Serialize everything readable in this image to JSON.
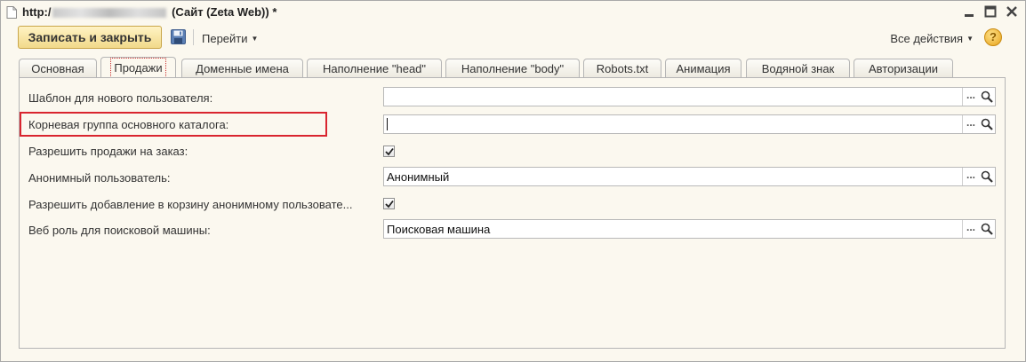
{
  "window": {
    "title_prefix": "http:/",
    "title_suffix": " (Сайт (Zeta Web)) *",
    "controls": [
      "minimize",
      "maximize",
      "close"
    ]
  },
  "toolbar": {
    "primary_label": "Записать и закрыть",
    "goto_label": "Перейти",
    "all_actions_label": "Все действия",
    "help_label": "?"
  },
  "tabs": [
    {
      "label": "Основная",
      "active": false
    },
    {
      "label": "Продажи",
      "active": true
    },
    {
      "label": "Доменные имена",
      "active": false
    },
    {
      "label": "Наполнение \"head\"",
      "active": false
    },
    {
      "label": "Наполнение \"body\"",
      "active": false
    },
    {
      "label": "Robots.txt",
      "active": false
    },
    {
      "label": "Анимация",
      "active": false
    },
    {
      "label": "Водяной знак",
      "active": false
    },
    {
      "label": "Авторизации",
      "active": false
    }
  ],
  "form": {
    "new_user_template": {
      "label": "Шаблон для нового пользователя:",
      "value": ""
    },
    "root_group": {
      "label": "Корневая группа основного каталога:",
      "value": ""
    },
    "allow_orders": {
      "label": "Разрешить продажи на заказ:",
      "checked": true
    },
    "anonymous_user": {
      "label": "Анонимный пользователь:",
      "value": "Анонимный"
    },
    "allow_anon_cart": {
      "label": "Разрешить добавление в корзину анонимному пользовате...",
      "checked": true
    },
    "search_engine_role": {
      "label": "Веб роль для поисковой машины:",
      "value": "Поисковая машина"
    }
  },
  "colors": {
    "background": "#fbf8ef",
    "primary_button": "#f1d98a",
    "highlight_border": "#d9252f"
  }
}
